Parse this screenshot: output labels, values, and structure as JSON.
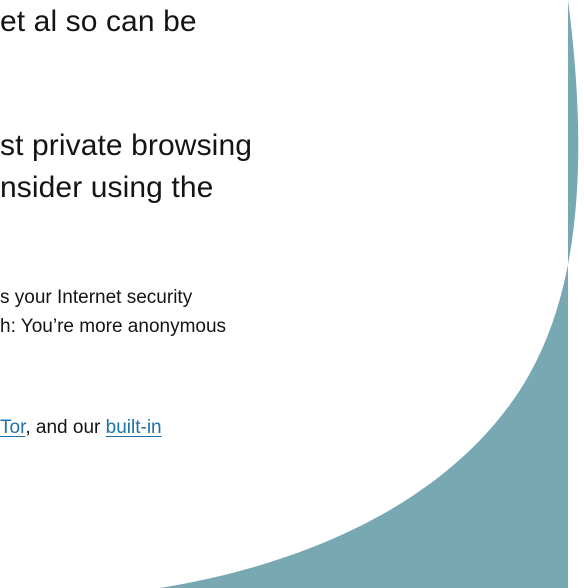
{
  "text": {
    "line1": "et al so can be",
    "line2": "st private browsing",
    "line3": "nsider using the",
    "line4": "s your Internet security",
    "line5": "h: You’re more anonymous",
    "line6_link1": "Tor",
    "line6_middle": ", and our ",
    "line6_link2": "built-in"
  },
  "colors": {
    "background": "#ffffff",
    "accent_shape": "#78a8b2",
    "link": "#1d73a9",
    "text": "#141414"
  }
}
